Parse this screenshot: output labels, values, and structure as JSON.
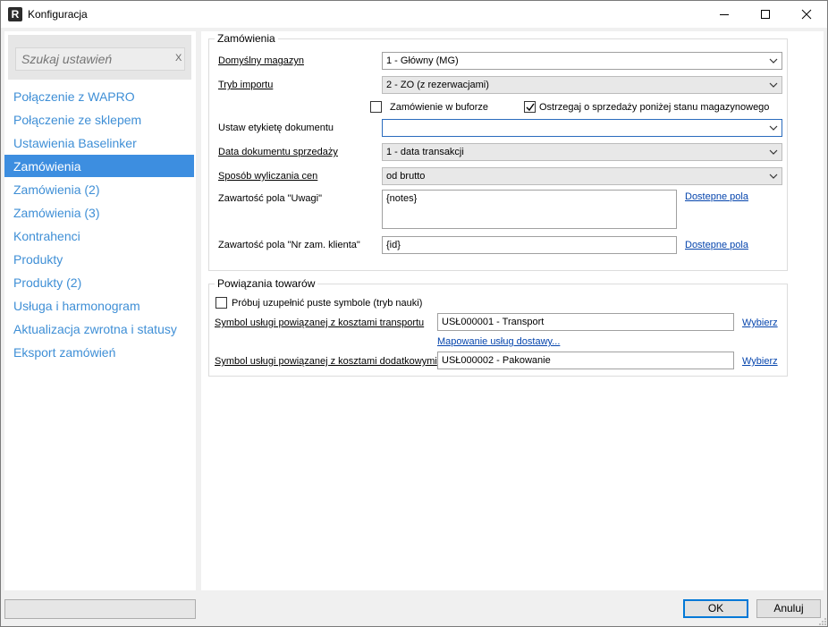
{
  "window": {
    "title": "Konfiguracja",
    "app_icon_letter": "R"
  },
  "sidebar": {
    "search": {
      "placeholder": "Szukaj ustawień",
      "clear_label": "X"
    },
    "items": [
      {
        "label": "Połączenie z WAPRO"
      },
      {
        "label": "Połączenie ze sklepem"
      },
      {
        "label": "Ustawienia Baselinker"
      },
      {
        "label": "Zamówienia",
        "active": true
      },
      {
        "label": "Zamówienia (2)"
      },
      {
        "label": "Zamówienia (3)"
      },
      {
        "label": "Kontrahenci"
      },
      {
        "label": "Produkty"
      },
      {
        "label": "Produkty (2)"
      },
      {
        "label": "Usługa i harmonogram"
      },
      {
        "label": "Aktualizacja zwrotna i statusy"
      },
      {
        "label": "Eksport zamówień"
      }
    ]
  },
  "orders_group": {
    "title": "Zamówienia",
    "default_warehouse": {
      "label": "Domyślny magazyn",
      "value": "1 - Główny (MG)"
    },
    "import_mode": {
      "label": "Tryb importu",
      "value": "2 - ZO (z rezerwacjami)"
    },
    "buffer_checkbox": {
      "label": "Zamówienie w buforze",
      "checked": false
    },
    "warn_checkbox": {
      "label": "Ostrzegaj o sprzedaży poniżej stanu magazynowego",
      "checked": true
    },
    "document_label": {
      "label": "Ustaw etykietę dokumentu",
      "value": ""
    },
    "sale_date": {
      "label": "Data dokumentu sprzedaży",
      "value": "1 - data transakcji"
    },
    "price_method": {
      "label": "Sposób wyliczania cen",
      "value": "od brutto"
    },
    "notes_field": {
      "label": "Zawartość pola \"Uwagi\"",
      "value": "{notes}",
      "link": "Dostepne pola"
    },
    "client_order_no": {
      "label": "Zawartość pola \"Nr zam. klienta\"",
      "value": "{id}",
      "link": "Dostepne pola"
    }
  },
  "products_group": {
    "title": "Powiązania towarów",
    "learning_checkbox": {
      "label": "Próbuj uzupełnić puste symbole (tryb nauki)",
      "checked": false
    },
    "transport_service": {
      "label": "Symbol usługi powiązanej z kosztami transportu",
      "value": "USŁ000001 - Transport",
      "link": "Wybierz"
    },
    "mapping_link": "Mapowanie usług dostawy...",
    "extra_service": {
      "label": "Symbol usługi powiązanej z kosztami dodatkowymi",
      "value": "USŁ000002 - Pakowanie",
      "link": "Wybierz"
    }
  },
  "footer": {
    "ok_label": "OK",
    "cancel_label": "Anuluj"
  },
  "colors": {
    "accent": "#3d8ee0",
    "nav_text": "#3f8fd6",
    "link": "#0645ad"
  }
}
